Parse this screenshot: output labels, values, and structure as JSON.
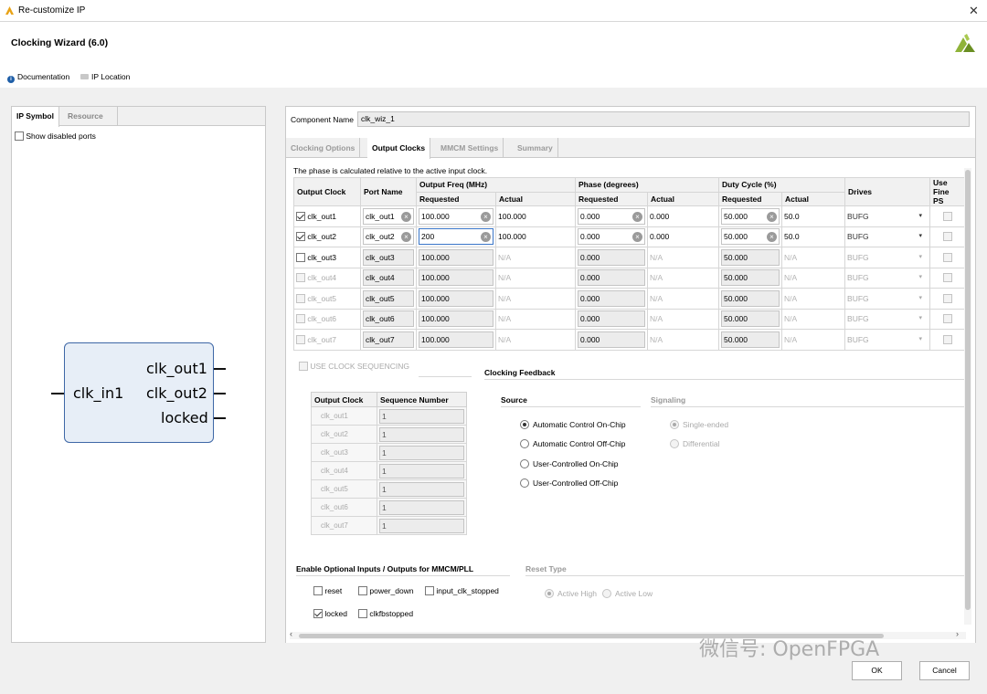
{
  "window": {
    "title": "Re-customize IP",
    "close_glyph": "✕"
  },
  "header": {
    "wizard_title": "Clocking Wizard (6.0)",
    "doc_link": "Documentation",
    "iploc_link": "IP Location"
  },
  "left": {
    "tabs": [
      "IP Symbol",
      "Resource"
    ],
    "show_disabled_ports": "Show disabled ports",
    "symbol": {
      "input_pin": "clk_in1",
      "output_pins": [
        "clk_out1",
        "clk_out2",
        "locked"
      ]
    }
  },
  "right": {
    "component_name_label": "Component Name",
    "component_name_value": "clk_wiz_1",
    "tabs": [
      "Clocking Options",
      "Output Clocks",
      "MMCM Settings",
      "Summary"
    ],
    "phase_note": "The phase is calculated relative to the active input clock.",
    "table_headers": {
      "output_clock": "Output Clock",
      "port_name": "Port Name",
      "output_freq": "Output Freq (MHz)",
      "phase": "Phase (degrees)",
      "duty": "Duty Cycle (%)",
      "drives": "Drives",
      "use_fine_ps": "Use Fine PS",
      "requested": "Requested",
      "actual": "Actual"
    },
    "clocks": [
      {
        "name": "clk_out1",
        "port": "clk_out1",
        "freq_req": "100.000",
        "freq_act": "100.000",
        "phase_req": "0.000",
        "phase_act": "0.000",
        "duty_req": "50.000",
        "duty_act": "50.0",
        "drives": "BUFG"
      },
      {
        "name": "clk_out2",
        "port": "clk_out2",
        "freq_req": "200",
        "freq_act": "100.000",
        "phase_req": "0.000",
        "phase_act": "0.000",
        "duty_req": "50.000",
        "duty_act": "50.0",
        "drives": "BUFG"
      },
      {
        "name": "clk_out3",
        "port": "clk_out3",
        "freq_req": "100.000",
        "freq_act": "N/A",
        "phase_req": "0.000",
        "phase_act": "N/A",
        "duty_req": "50.000",
        "duty_act": "N/A",
        "drives": "BUFG"
      },
      {
        "name": "clk_out4",
        "port": "clk_out4",
        "freq_req": "100.000",
        "freq_act": "N/A",
        "phase_req": "0.000",
        "phase_act": "N/A",
        "duty_req": "50.000",
        "duty_act": "N/A",
        "drives": "BUFG"
      },
      {
        "name": "clk_out5",
        "port": "clk_out5",
        "freq_req": "100.000",
        "freq_act": "N/A",
        "phase_req": "0.000",
        "phase_act": "N/A",
        "duty_req": "50.000",
        "duty_act": "N/A",
        "drives": "BUFG"
      },
      {
        "name": "clk_out6",
        "port": "clk_out6",
        "freq_req": "100.000",
        "freq_act": "N/A",
        "phase_req": "0.000",
        "phase_act": "N/A",
        "duty_req": "50.000",
        "duty_act": "N/A",
        "drives": "BUFG"
      },
      {
        "name": "clk_out7",
        "port": "clk_out7",
        "freq_req": "100.000",
        "freq_act": "N/A",
        "phase_req": "0.000",
        "phase_act": "N/A",
        "duty_req": "50.000",
        "duty_act": "N/A",
        "drives": "BUFG"
      }
    ],
    "use_clock_sequencing": "USE CLOCK SEQUENCING",
    "sequencing": {
      "headers": [
        "Output Clock",
        "Sequence Number"
      ],
      "rows": [
        {
          "clock": "clk_out1",
          "seq": "1"
        },
        {
          "clock": "clk_out2",
          "seq": "1"
        },
        {
          "clock": "clk_out3",
          "seq": "1"
        },
        {
          "clock": "clk_out4",
          "seq": "1"
        },
        {
          "clock": "clk_out5",
          "seq": "1"
        },
        {
          "clock": "clk_out6",
          "seq": "1"
        },
        {
          "clock": "clk_out7",
          "seq": "1"
        }
      ]
    },
    "feedback": {
      "title": "Clocking Feedback",
      "source_label": "Source",
      "signaling_label": "Signaling",
      "source_options": [
        "Automatic Control On-Chip",
        "Automatic Control Off-Chip",
        "User-Controlled On-Chip",
        "User-Controlled Off-Chip"
      ],
      "signaling_options": [
        "Single-ended",
        "Differential"
      ]
    },
    "optional_io": {
      "title": "Enable Optional Inputs / Outputs for MMCM/PLL",
      "items": [
        "reset",
        "power_down",
        "input_clk_stopped",
        "locked",
        "clkfbstopped"
      ]
    },
    "reset_type": {
      "title": "Reset Type",
      "options": [
        "Active High",
        "Active Low"
      ]
    }
  },
  "buttons": {
    "ok": "OK",
    "cancel": "Cancel"
  },
  "watermark": "微信号: OpenFPGA",
  "colors": {
    "accent": "#3a76c9",
    "symbol_fill": "#e7eef7",
    "symbol_border": "#3e67a6"
  }
}
